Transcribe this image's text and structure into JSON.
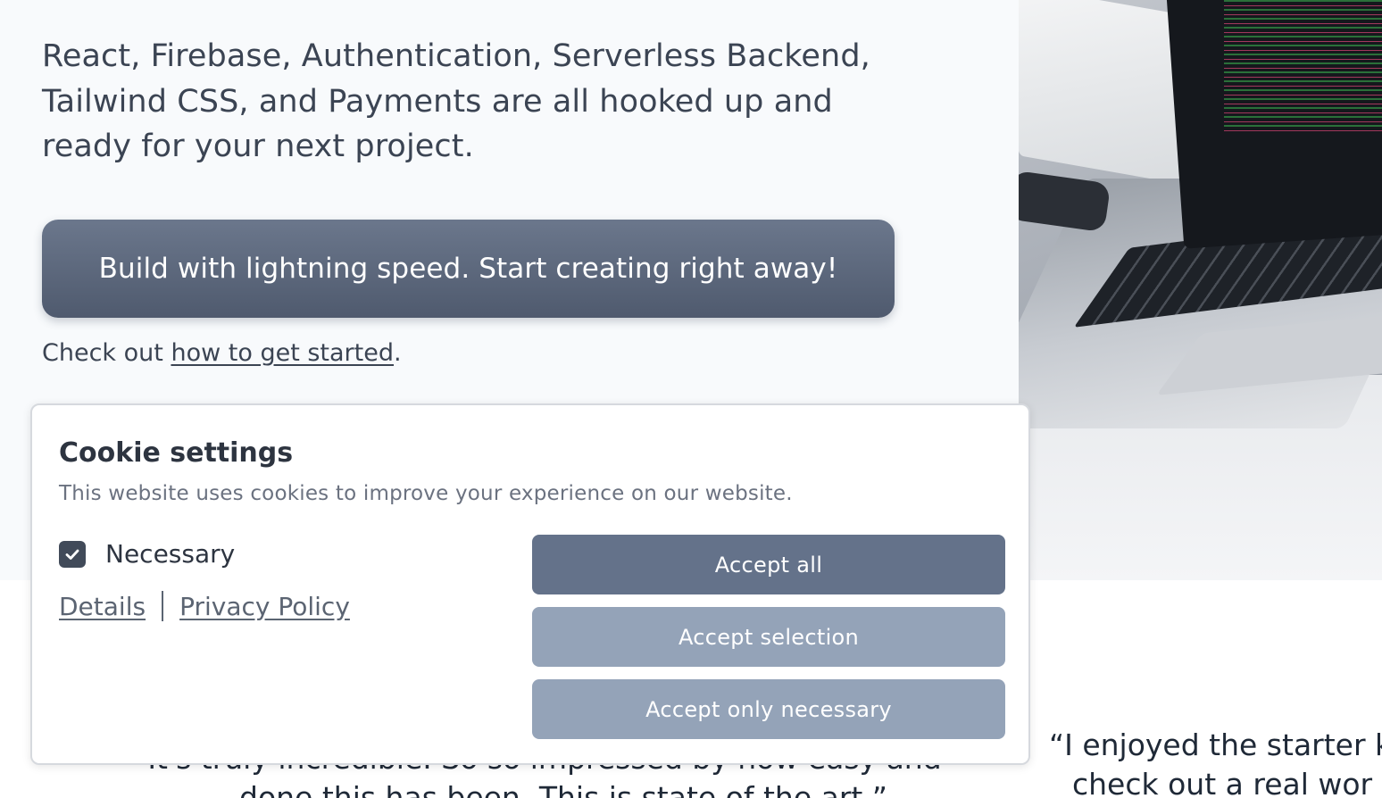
{
  "hero": {
    "description": "React, Firebase, Authentication, Serverless Backend, Tailwind CSS, and Payments are all hooked up and ready for your next project.",
    "cta_label": "Build with lightning speed. Start creating right away!",
    "check_out_prefix": "Check out ",
    "check_out_link": "how to get started",
    "check_out_suffix": "."
  },
  "testimonials": {
    "left_line1": "It's truly incredible. So so impressed by how easy and",
    "left_line2": "... done this has been. This is state of the art.”",
    "right_line1": "“I enjoyed the starter k",
    "right_line2": "check out a real wor"
  },
  "cookie": {
    "title": "Cookie settings",
    "description": "This website uses cookies to improve your experience on our website.",
    "necessary_label": "Necessary",
    "necessary_checked": true,
    "details_link": "Details",
    "privacy_link": "Privacy Policy",
    "accept_all": "Accept all",
    "accept_selection": "Accept selection",
    "accept_only_necessary": "Accept only necessary"
  },
  "icons": {
    "checkbox": "check-icon"
  },
  "colors": {
    "cta_bg": "#5b667a",
    "accept_all_bg": "#64728a",
    "secondary_btn_bg": "#94a3b8",
    "text_dark": "#2d3440"
  }
}
